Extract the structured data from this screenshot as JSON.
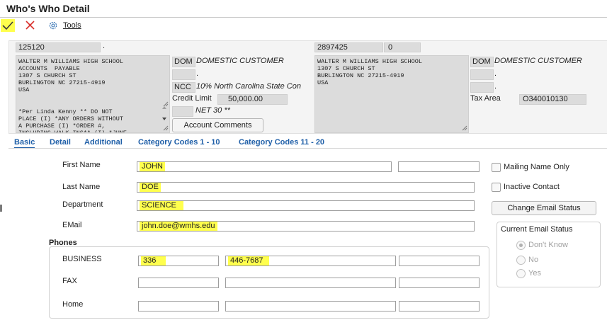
{
  "window": {
    "title": "Who's Who Detail"
  },
  "toolbar": {
    "tools_label": "Tools"
  },
  "header": {
    "left": {
      "number": "125120",
      "number_suffix": ".",
      "address_lines": "WALTER M WILLIAMS HIGH SCHOOL\nACCOUNTS  PAYABLE\n1307 S CHURCH ST\nBURLINGTON NC 27215-4919\nUSA",
      "notes_lines": "*Per Linda Kenny ** DO NOT\nPLACE (I) *ANY ORDERS WITHOUT\nA PURCHASE (I) *ORDER #,\nINCLUDING WALK INS** (I) *JUNE",
      "customer_code": "DOM",
      "customer_type": "DOMESTIC CUSTOMER",
      "dot2": ".",
      "tax_code": "NCC",
      "tax_desc": "10% North Carolina State Con",
      "credit_limit_label": "Credit Limit",
      "credit_limit": "50,000.00",
      "terms": "NET 30 **",
      "account_comments_label": "Account Comments"
    },
    "right": {
      "number": "2897425",
      "number2": "0",
      "address_lines": "WALTER M WILLIAMS HIGH SCHOOL\n1307 S CHURCH ST\nBURLINGTON NC 27215-4919\nUSA",
      "customer_code": "DOM",
      "customer_type": "DOMESTIC CUSTOMER",
      "dot2": ".",
      "dot3": ".",
      "tax_area_label": "Tax Area",
      "tax_area": "O340010130"
    }
  },
  "tabs": [
    "Basic",
    "Detail",
    "Additional",
    "Category Codes 1 - 10",
    "Category Codes 11 - 20"
  ],
  "form": {
    "first_name_label": "First Name",
    "first_name": "JOHN",
    "last_name_label": "Last Name",
    "last_name": "DOE",
    "department_label": "Department",
    "department": "SCIENCE",
    "email_label": "EMail",
    "email": "john.doe@wmhs.edu",
    "mailing_name_only_label": "Mailing Name Only",
    "inactive_contact_label": "Inactive Contact",
    "change_email_status_label": "Change Email Status",
    "current_email_status_label": "Current Email Status",
    "email_status_options": [
      "Don't Know",
      "No",
      "Yes"
    ],
    "email_status_selected": "Don't Know"
  },
  "phones": {
    "section_label": "Phones",
    "rows": [
      {
        "label": "BUSINESS",
        "prefix": "336",
        "number": "446-7687",
        "extra": ""
      },
      {
        "label": "FAX",
        "prefix": "",
        "number": "",
        "extra": ""
      },
      {
        "label": "Home",
        "prefix": "",
        "number": "",
        "extra": ""
      }
    ]
  }
}
